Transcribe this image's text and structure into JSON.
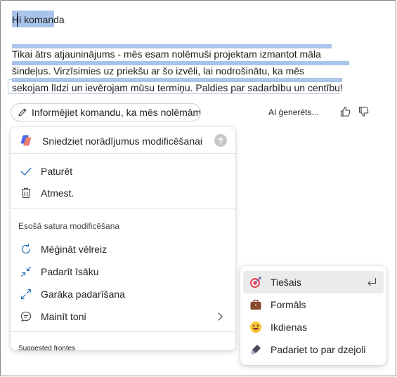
{
  "document": {
    "title": "Hi komanda",
    "paragraph_lines": [
      "Tikai ātrs atjauninājums - mēs esam nolēmuši projektam izmantot māla",
      "šindeļus. Virzīsimies uz priekšu ar šo izvēli, lai nodrošinātu, ka mēs",
      "sekojam līdzi un ievērojam mūsu termiņu. Paldies par sadarbību un centību!"
    ]
  },
  "prompt_bar": {
    "prompt_text": "Informējiet komandu, ka mēs nolēmām izmantot māla šindeļus",
    "ai_label": "AI ģenerēts...",
    "thumb_up_icon": "thumb-up-icon",
    "thumb_down_icon": "thumb-down-icon"
  },
  "menu": {
    "input_placeholder": "Sniedziet norādījumus modificēšanai",
    "keep_label": "Paturēt",
    "discard_label": "Atmest.",
    "section_label": "Esošā satura modificēšana",
    "retry_label": "Mēģināt vēlreiz",
    "shorten_label": "Padarīt īsāku",
    "lengthen_label": "Garāka padarīšana",
    "change_tone_label": "Mainīt toni",
    "suggested_label": "Suggested frontes"
  },
  "tone_submenu": {
    "items": [
      {
        "label": "Tiešais",
        "icon": "target-icon",
        "active": true
      },
      {
        "label": "Formāls",
        "icon": "briefcase-icon",
        "active": false
      },
      {
        "label": "Ikdienas",
        "icon": "smile-icon",
        "active": false
      },
      {
        "label": "Padariet to par dzejoli",
        "icon": "fountain-pen-icon",
        "active": false
      }
    ]
  },
  "colors": {
    "selection": "#a9c4ea",
    "border": "#8a8a8a",
    "menu_hover": "#ebebeb"
  }
}
